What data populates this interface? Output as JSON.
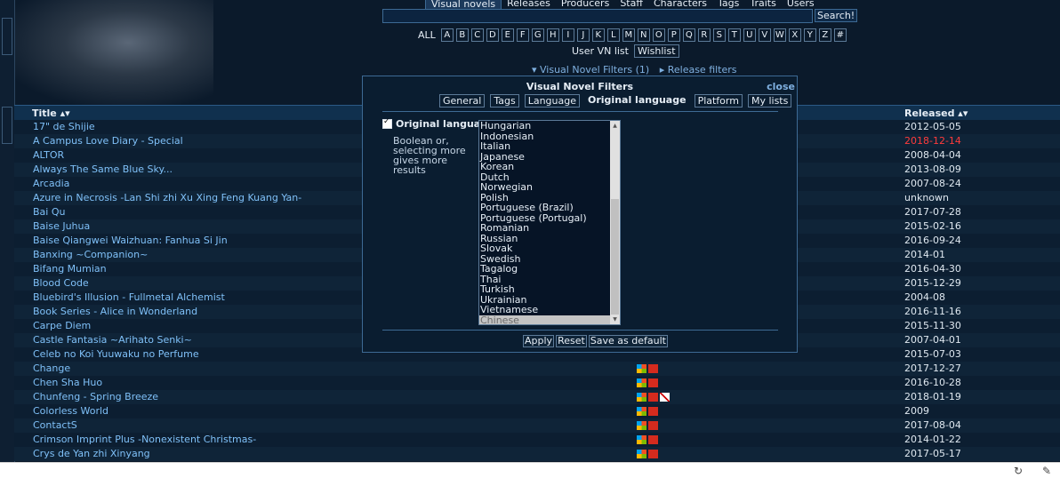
{
  "nav": {
    "items": [
      "Visual novels",
      "Releases",
      "Producers",
      "Staff",
      "Characters",
      "Tags",
      "Traits",
      "Users"
    ],
    "active": "Visual novels"
  },
  "search": {
    "button_label": "Search!",
    "value": ""
  },
  "alphabet": {
    "all_label": "ALL",
    "letters": [
      "A",
      "B",
      "C",
      "D",
      "E",
      "F",
      "G",
      "H",
      "I",
      "J",
      "K",
      "L",
      "M",
      "N",
      "O",
      "P",
      "Q",
      "R",
      "S",
      "T",
      "U",
      "V",
      "W",
      "X",
      "Y",
      "Z",
      "#"
    ]
  },
  "user_vn_list": {
    "label": "User VN list",
    "wishlist_label": "Wishlist"
  },
  "filter_links": {
    "vn_filters": "▾ Visual Novel Filters (1)",
    "release_filters": "▸ Release filters"
  },
  "table": {
    "title_header": "Title ▴▾",
    "released_header": "Released ▴▾",
    "rows": [
      {
        "title": "17\" de Shijie",
        "date": "2012-05-05",
        "icons": []
      },
      {
        "title": "A Campus Love Diary - Special",
        "date": "2018-12-14",
        "icons": [],
        "future": true
      },
      {
        "title": "ALTOR",
        "date": "2008-04-04",
        "icons": []
      },
      {
        "title": "Always The Same Blue Sky...",
        "date": "2013-08-09",
        "icons": []
      },
      {
        "title": "Arcadia",
        "date": "2007-08-24",
        "icons": []
      },
      {
        "title": "Azure in Necrosis -Lan Shi zhi Xu Xing Feng Kuang Yan-",
        "date": "unknown",
        "icons": []
      },
      {
        "title": "Bai Qu",
        "date": "2017-07-28",
        "icons": []
      },
      {
        "title": "Baise Juhua",
        "date": "2015-02-16",
        "icons": []
      },
      {
        "title": "Baise Qiangwei Waizhuan: Fanhua Si Jin",
        "date": "2016-09-24",
        "icons": []
      },
      {
        "title": "Banxing ~Companion~",
        "date": "2014-01",
        "icons": []
      },
      {
        "title": "Bifang Mumian",
        "date": "2016-04-30",
        "icons": []
      },
      {
        "title": "Blood Code",
        "date": "2015-12-29",
        "icons": []
      },
      {
        "title": "Bluebird's Illusion - Fullmetal Alchemist",
        "date": "2004-08",
        "icons": []
      },
      {
        "title": "Book Series - Alice in Wonderland",
        "date": "2016-11-16",
        "icons": []
      },
      {
        "title": "Carpe Diem",
        "date": "2015-11-30",
        "icons": []
      },
      {
        "title": "Castle Fantasia ~Arihato Senki~",
        "date": "2007-04-01",
        "icons": []
      },
      {
        "title": "Celeb no Koi Yuuwaku no Perfume",
        "date": "2015-07-03",
        "icons": []
      },
      {
        "title": "Change",
        "date": "2017-12-27",
        "icons": [
          "windows-icon",
          "china-flag-icon"
        ]
      },
      {
        "title": "Chen Sha Huo",
        "date": "2016-10-28",
        "icons": [
          "windows-icon",
          "china-flag-icon"
        ]
      },
      {
        "title": "Chunfeng - Spring Breeze",
        "date": "2018-01-19",
        "icons": [
          "windows-icon",
          "china-flag-icon",
          "uk-flag-icon"
        ]
      },
      {
        "title": "Colorless World",
        "date": "2009",
        "icons": [
          "windows-icon",
          "china-flag-icon"
        ]
      },
      {
        "title": "ContactS",
        "date": "2017-08-04",
        "icons": [
          "windows-icon",
          "china-flag-icon"
        ]
      },
      {
        "title": "Crimson Imprint Plus -Nonexistent Christmas-",
        "date": "2014-01-22",
        "icons": [
          "windows-icon",
          "china-flag-icon"
        ]
      },
      {
        "title": "Crys de Yan zhi Xinyang",
        "date": "2017-05-17",
        "icons": [
          "windows-icon",
          "china-flag-icon"
        ]
      }
    ]
  },
  "dialog": {
    "title": "Visual Novel Filters",
    "close_label": "close",
    "tabs": [
      "General",
      "Tags",
      "Language",
      "Original language",
      "Platform",
      "My lists"
    ],
    "active_tab": "Original language",
    "checkbox_label": "Original language",
    "help_text": "Boolean or, selecting more gives more results",
    "languages": [
      "Hungarian",
      "Indonesian",
      "Italian",
      "Japanese",
      "Korean",
      "Dutch",
      "Norwegian",
      "Polish",
      "Portuguese (Brazil)",
      "Portuguese (Portugal)",
      "Romanian",
      "Russian",
      "Slovak",
      "Swedish",
      "Tagalog",
      "Thai",
      "Turkish",
      "Ukrainian",
      "Vietnamese",
      "Chinese"
    ],
    "selected_language": "Chinese",
    "buttons": [
      "Apply",
      "Reset",
      "Save as default"
    ]
  }
}
